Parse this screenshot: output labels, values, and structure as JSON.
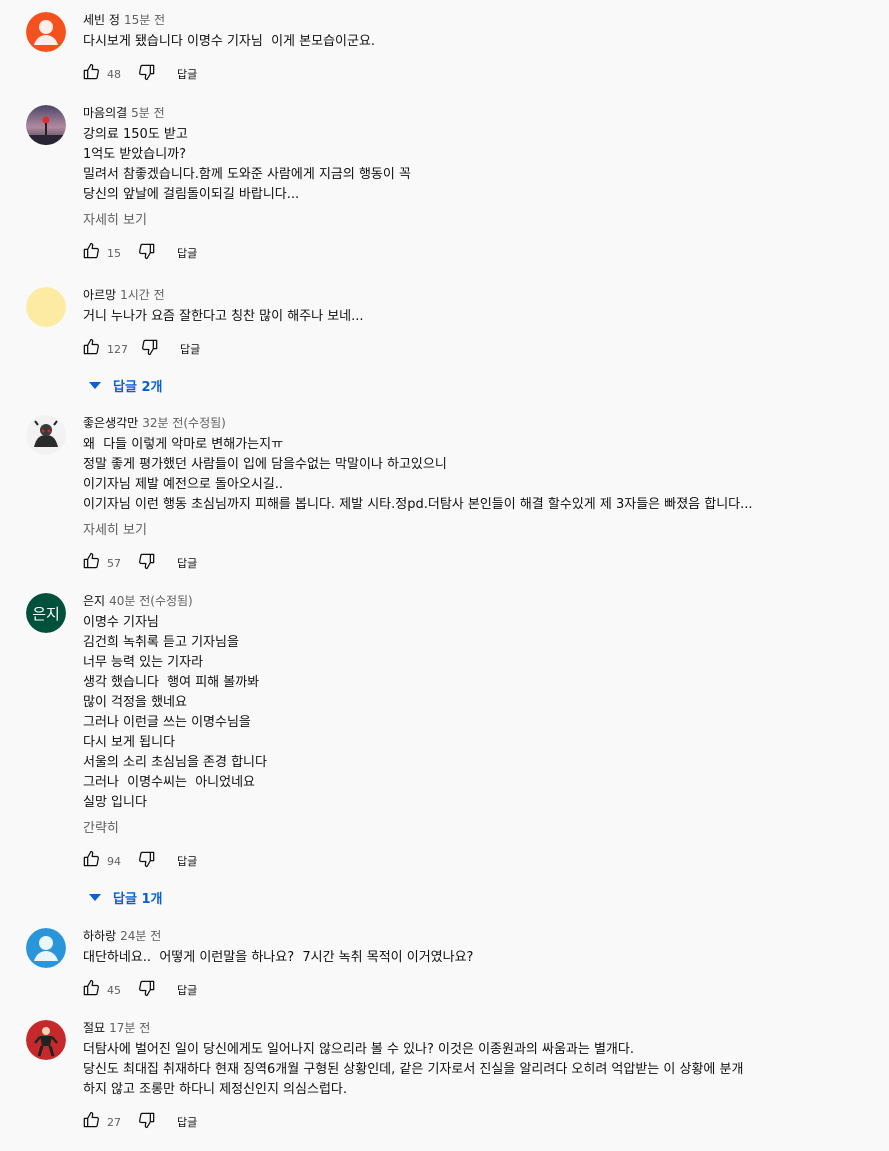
{
  "comments": [
    {
      "author": "세빈 정",
      "time": "15분 전",
      "lines": [
        "다시보게 됐습니다 이명수 기자님  이게 본모습이군요."
      ],
      "more": "",
      "likes": "48",
      "reply": "답글",
      "replies_label": "",
      "avatar": {
        "type": "default-person",
        "color": "#f4511e"
      }
    },
    {
      "author": "마음의결",
      "time": "5분 전",
      "lines": [
        "강의료 150도 받고",
        "1억도 받았습니까?",
        "밀려서 참좋겠습니다.함께 도와준 사람에게 지금의 행동이 꼭",
        "당신의 앞날에 걸림돌이되길 바랍니다..."
      ],
      "more": "자세히 보기",
      "likes": "15",
      "reply": "답글",
      "replies_label": "",
      "avatar": {
        "type": "photo-sunset",
        "color": "#3b3550"
      }
    },
    {
      "author": "아르망",
      "time": "1시간 전",
      "lines": [
        "거니 누나가 요즘 잘한다고 칭찬 많이 해주나 보네..."
      ],
      "more": "",
      "likes": "127",
      "reply": "답글",
      "replies_label": "답글 2개",
      "avatar": {
        "type": "plain",
        "color": "#fdeba3"
      }
    },
    {
      "author": "좋은생각만",
      "time": "32분 전(수정됨)",
      "lines": [
        "왜  다들 이렇게 악마로 변해가는지ㅠ",
        "정말 좋게 평가했던 사람들이 입에 담을수없는 막말이나 하고있으니",
        "이기자님 제발 예전으로 돌아오시길..",
        "이기자님 이런 행동 초심님까지 피해를 봅니다. 제발 시타.정pd.더탐사 본인들이 해결 할수있게 제 3자들은 빠졌음 합니다..."
      ],
      "more": "자세히 보기",
      "likes": "57",
      "reply": "답글",
      "replies_label": "",
      "avatar": {
        "type": "photo-character",
        "color": "#333333"
      }
    },
    {
      "author": "은지",
      "time": "40분 전(수정됨)",
      "lines": [
        "이명수 기자님",
        "김건희 녹취록 듣고 기자님을",
        "너무 능력 있는 기자라",
        "생각 했습니다  행여 피해 볼까봐",
        "많이 걱정을 했네요",
        "그러나 이런글 쓰는 이명수님을",
        "다시 보게 됩니다",
        "서울의 소리 초심님을 존경 합니다",
        "그러나  이명수씨는  아니었네요",
        "실망 입니다"
      ],
      "more": "간략히",
      "likes": "94",
      "reply": "답글",
      "replies_label": "답글 1개",
      "avatar": {
        "type": "initials",
        "text": "은지",
        "color": "#00513b"
      }
    },
    {
      "author": "하하랑",
      "time": "24분 전",
      "lines": [
        "대단하네요..  어떻게 이런말을 하나요?  7시간 녹취 목적이 이거였나요?"
      ],
      "more": "",
      "likes": "45",
      "reply": "답글",
      "replies_label": "",
      "avatar": {
        "type": "default-person",
        "color": "#2996dc"
      }
    },
    {
      "author": "절묘",
      "time": "17분 전",
      "lines": [
        "더탐사에 벌어진 일이 당신에게도 일어나지 않으리라 볼 수 있나? 이것은 이종원과의 싸움과는 별개다.",
        "당신도 최대집 취재하다 현재 징역6개월 구형된 상황인데, 같은 기자로서 진실을 알리려다 오히려 억압받는 이 상황에 분개",
        "하지 않고 조롱만 하다니 제정신인지 의심스럽다."
      ],
      "more": "",
      "likes": "27",
      "reply": "답글",
      "replies_label": "",
      "avatar": {
        "type": "photo-figure",
        "color": "#c62828"
      }
    }
  ]
}
